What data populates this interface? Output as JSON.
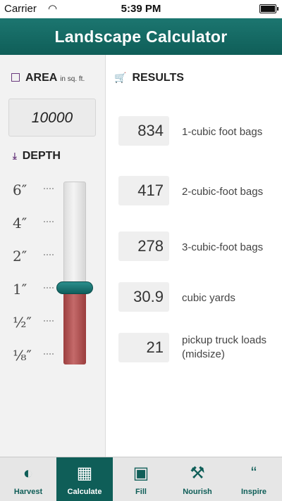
{
  "status_bar": {
    "carrier": "Carrier",
    "time": "5:39 PM"
  },
  "nav_bar": {
    "title": "Landscape Calculator"
  },
  "area": {
    "label": "AREA",
    "unit": "in sq. ft.",
    "value": "10000",
    "icon": "checkbox-icon"
  },
  "depth": {
    "label": "DEPTH",
    "icon": "download-icon",
    "ticks": [
      "6″",
      "4″",
      "2″",
      "1″",
      "¹⁄₂″",
      "¹⁄₈″"
    ],
    "selected": "1″"
  },
  "results": {
    "header": "RESULTS",
    "icon": "cart-icon",
    "items": [
      {
        "value": "834",
        "label": "1-cubic foot bags"
      },
      {
        "value": "417",
        "label": "2-cubic-foot bags"
      },
      {
        "value": "278",
        "label": "3-cubic-foot bags"
      },
      {
        "value": "30.9",
        "label": "cubic yards"
      },
      {
        "value": "21",
        "label": "pickup truck loads (midsize)"
      }
    ]
  },
  "tabs": [
    {
      "label": "Harvest",
      "icon": "harvest-icon",
      "glyph": "◐"
    },
    {
      "label": "Calculate",
      "icon": "calculator-icon",
      "glyph": "▦"
    },
    {
      "label": "Fill",
      "icon": "fill-icon",
      "glyph": "▣"
    },
    {
      "label": "Nourish",
      "icon": "shovel-icon",
      "glyph": "⚒"
    },
    {
      "label": "Inspire",
      "icon": "quote-icon",
      "glyph": "“"
    }
  ],
  "colors": {
    "brand": "#0f5e58",
    "accent": "#6a3b7d",
    "fill": "#b55454"
  }
}
